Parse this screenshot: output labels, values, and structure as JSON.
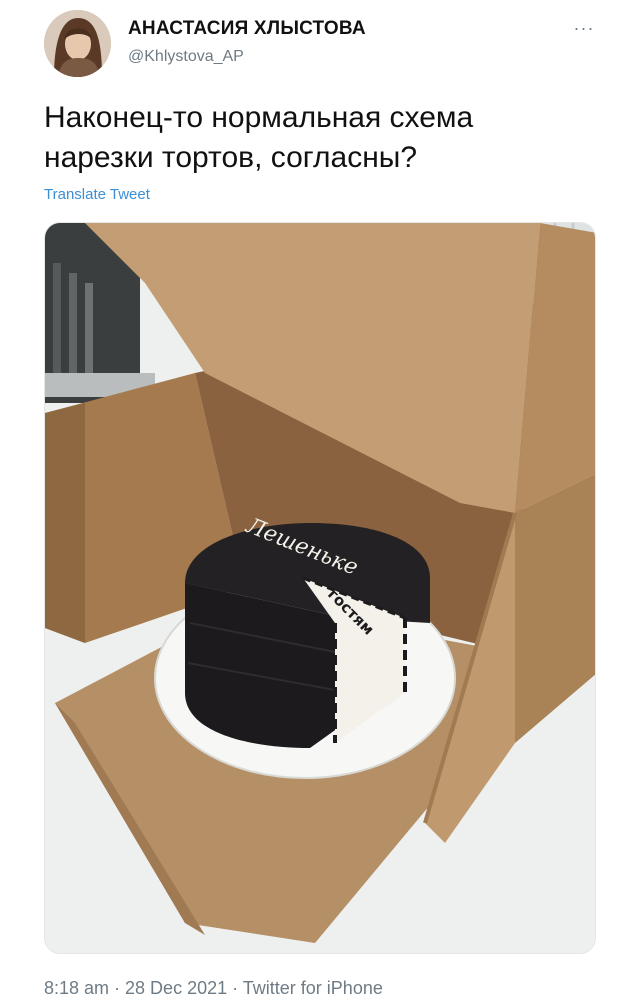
{
  "author": {
    "display_name": "АНАСТАСИЯ ХЛЫСТОВА",
    "handle": "@Khlystova_AP",
    "avatar_icon": "person-avatar-icon"
  },
  "menu": {
    "more_label": "···",
    "icon": "more-dots-icon"
  },
  "tweet": {
    "text": "Наконец-то нормальная схема\nнарезки тортов, согласны?",
    "translate_label": "Translate Tweet",
    "link_color": "#3a8fd6"
  },
  "image": {
    "cake_text_top": "Лешеньке",
    "cake_text_slice": "гостям",
    "cake_color": "#1c1a1c",
    "cream_color": "#f4f1ea",
    "box_color": "#b7926a"
  },
  "footer": {
    "timestamp": "8:18 am · 28 Dec 2021 · Twitter for iPhone"
  }
}
